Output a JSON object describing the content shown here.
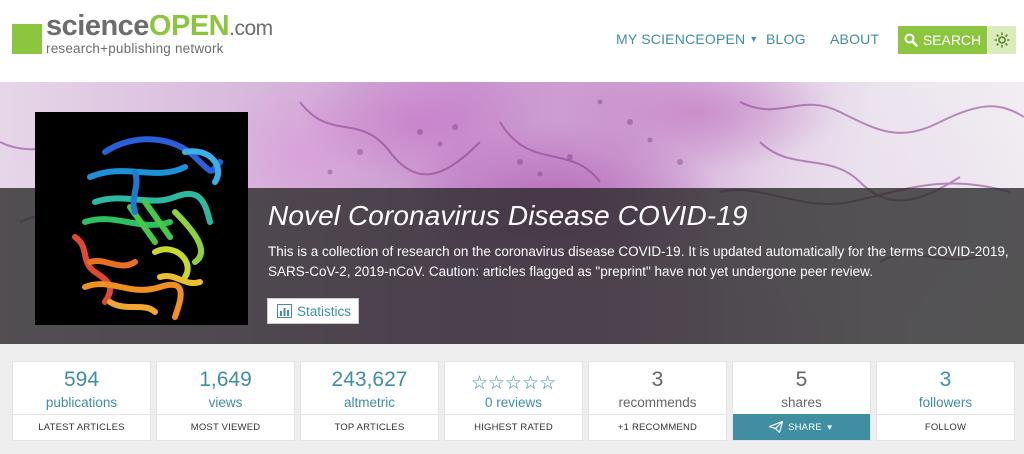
{
  "header": {
    "logo_science": "science",
    "logo_open": "OPEN",
    "logo_com": ".com",
    "logo_tagline": "research+publishing network",
    "nav": {
      "my_scienceopen": "MY SCIENCEOPEN",
      "blog": "BLOG",
      "about": "ABOUT"
    },
    "search_label": "SEARCH",
    "colors": {
      "brand_green": "#8cc63f",
      "nav_teal": "#3f8fa0"
    }
  },
  "hero": {
    "title": "Novel Coronavirus Disease COVID-19",
    "description": "This is a collection of research on the coronavirus disease COVID-19. It is updated automatically for the terms COVID-2019, SARS-CoV-2, 2019-nCoV. Caution: articles flagged as \"preprint\" have not yet undergone peer review.",
    "statistics_label": "Statistics"
  },
  "stats": [
    {
      "value": "594",
      "label": "publications",
      "action": "LATEST ARTICLES"
    },
    {
      "value": "1,649",
      "label": "views",
      "action": "MOST VIEWED"
    },
    {
      "value": "243,627",
      "label": "altmetric",
      "action": "TOP ARTICLES"
    },
    {
      "value": "",
      "label": "0 reviews",
      "action": "HIGHEST RATED",
      "rating_stars": 0,
      "rating_max": 5
    },
    {
      "value": "3",
      "label": "recommends",
      "action": "+1 RECOMMEND"
    },
    {
      "value": "5",
      "label": "shares",
      "action": "SHARE"
    },
    {
      "value": "3",
      "label": "followers",
      "action": "FOLLOW"
    }
  ]
}
